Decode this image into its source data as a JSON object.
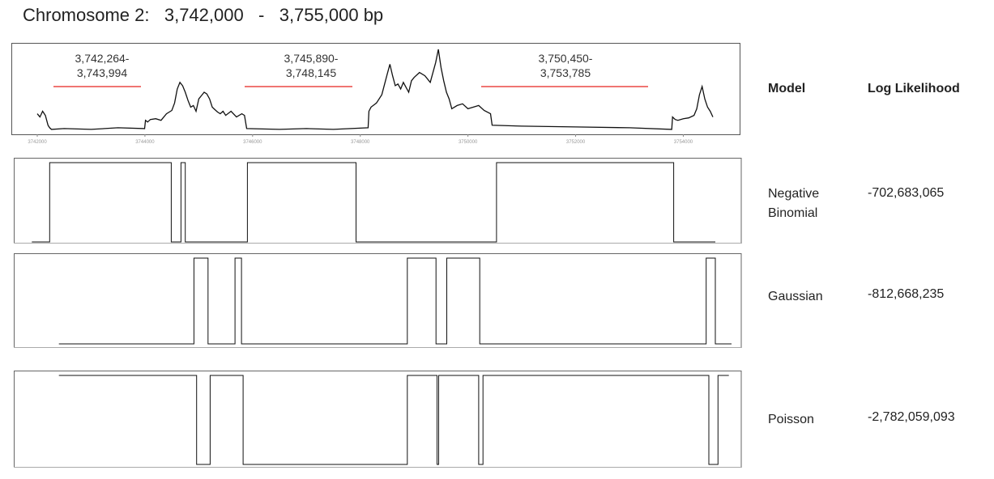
{
  "title": "Chromosome 2:   3,742,000   -   3,755,000 bp",
  "table": {
    "header_model": "Model",
    "header_ll": "Log Likelihood",
    "rows": [
      {
        "model": "Negative Binomial",
        "ll": "-702,683,065"
      },
      {
        "model": "Gaussian",
        "ll": "-812,668,235"
      },
      {
        "model": "Poisson",
        "ll": "-2,782,059,093"
      }
    ]
  },
  "chart_data": [
    {
      "type": "line",
      "title": "",
      "xlabel": "",
      "ylabel": "",
      "xlim": [
        3741900,
        3754700
      ],
      "ylim": [
        0,
        100
      ],
      "x_ticks": [
        "3742000",
        "3744000",
        "3746000",
        "3748000",
        "3750000",
        "3752000",
        "3754000"
      ],
      "grid": false,
      "series": [
        {
          "x": [
            3742000,
            3742050,
            3742100,
            3742150,
            3742200,
            3742230,
            3742264,
            3742500,
            3743000,
            3743500,
            3743994,
            3744010,
            3744050,
            3744100,
            3744200,
            3744300,
            3744400,
            3744500,
            3744550,
            3744600,
            3744650,
            3744700,
            3744750,
            3744800,
            3744850,
            3744900,
            3744950,
            3745000,
            3745050,
            3745100,
            3745150,
            3745200,
            3745250,
            3745300,
            3745350,
            3745400,
            3745450,
            3745500,
            3745600,
            3745700,
            3745800,
            3745850,
            3745890,
            3746500,
            3747000,
            3747500,
            3748145,
            3748160,
            3748200,
            3748300,
            3748400,
            3748500,
            3748550,
            3748600,
            3748650,
            3748700,
            3748750,
            3748800,
            3748850,
            3748900,
            3748950,
            3749000,
            3749100,
            3749200,
            3749300,
            3749400,
            3749450,
            3749500,
            3749550,
            3749600,
            3749650,
            3749700,
            3749800,
            3749900,
            3750000,
            3750100,
            3750200,
            3750300,
            3750420,
            3750450,
            3751000,
            3752000,
            3753000,
            3753785,
            3753800,
            3753850,
            3753900,
            3754000,
            3754100,
            3754200,
            3754250,
            3754300,
            3754350,
            3754400,
            3754450,
            3754500,
            3754550
          ],
          "y": [
            22,
            18,
            25,
            20,
            8,
            5,
            3,
            4,
            3,
            5,
            4,
            14,
            12,
            15,
            16,
            14,
            22,
            26,
            35,
            52,
            60,
            56,
            48,
            38,
            30,
            32,
            25,
            40,
            44,
            48,
            46,
            40,
            30,
            27,
            24,
            22,
            25,
            20,
            25,
            18,
            22,
            20,
            4,
            3,
            4,
            3,
            5,
            25,
            30,
            35,
            45,
            70,
            82,
            68,
            56,
            58,
            52,
            60,
            54,
            48,
            62,
            66,
            72,
            68,
            60,
            84,
            100,
            78,
            62,
            48,
            40,
            28,
            32,
            34,
            28,
            30,
            32,
            26,
            22,
            8,
            7,
            6,
            5,
            3,
            18,
            15,
            14,
            16,
            17,
            20,
            28,
            45,
            55,
            40,
            30,
            25,
            18
          ]
        }
      ],
      "annotations": [
        "3,742,264-\n3,743,994",
        "3,745,890-\n3,748,145",
        "3,750,450-\n3,753,785"
      ],
      "annotation_ranges": [
        [
          3742264,
          3743994
        ],
        [
          3745890,
          3748145
        ],
        [
          3750450,
          3753785
        ]
      ],
      "annotation_color": "#e8231e"
    },
    {
      "type": "line",
      "title": "Negative Binomial",
      "xlim": [
        3741900,
        3754700
      ],
      "ylim": [
        0,
        1
      ],
      "series": [
        {
          "x": [
            3741900,
            3742230,
            3742230,
            3744480,
            3744480,
            3744660,
            3744660,
            3744740,
            3744740,
            3745890,
            3745890,
            3747900,
            3747900,
            3750500,
            3750500,
            3753780,
            3753780,
            3754550
          ],
          "y": [
            0,
            0,
            1,
            1,
            0,
            0,
            1,
            1,
            0,
            0,
            1,
            1,
            0,
            0,
            1,
            1,
            0,
            0
          ]
        }
      ]
    },
    {
      "type": "line",
      "title": "Gaussian",
      "xlim": [
        3741900,
        3754700
      ],
      "ylim": [
        0,
        1
      ],
      "series": [
        {
          "x": [
            3742400,
            3744900,
            3744900,
            3745160,
            3745160,
            3745660,
            3745660,
            3745780,
            3745780,
            3748850,
            3748850,
            3749380,
            3749380,
            3749580,
            3749580,
            3750190,
            3750190,
            3754380,
            3754380,
            3754550,
            3754550,
            3754850
          ],
          "y": [
            0,
            0,
            1,
            1,
            0,
            0,
            1,
            1,
            0,
            0,
            1,
            1,
            0,
            0,
            1,
            1,
            0,
            0,
            1,
            1,
            0,
            0
          ]
        }
      ]
    },
    {
      "type": "line",
      "title": "Poisson",
      "xlim": [
        3741900,
        3754700
      ],
      "ylim": [
        0,
        1
      ],
      "series": [
        {
          "x": [
            3742400,
            3744950,
            3744950,
            3745200,
            3745200,
            3745810,
            3745810,
            3748850,
            3748850,
            3749400,
            3749400,
            3749430,
            3749430,
            3750170,
            3750170,
            3750250,
            3750250,
            3754430,
            3754430,
            3754600,
            3754600,
            3754800
          ],
          "y": [
            1,
            1,
            0,
            0,
            1,
            1,
            0,
            0,
            1,
            1,
            0,
            0,
            1,
            1,
            0,
            0,
            1,
            1,
            0,
            0,
            1,
            1
          ]
        }
      ]
    }
  ]
}
